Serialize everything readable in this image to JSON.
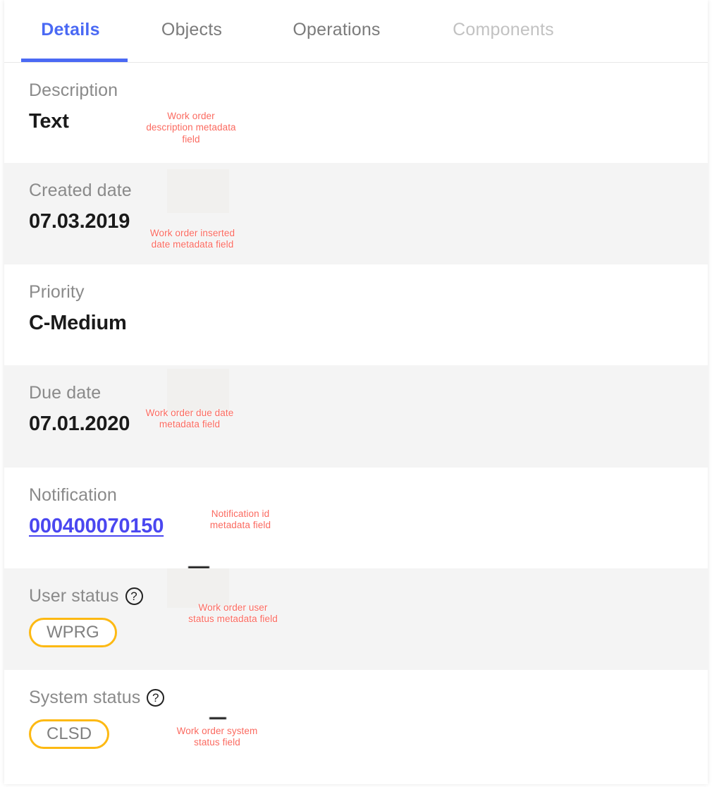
{
  "tabs": [
    {
      "label": "Details",
      "state": "active"
    },
    {
      "label": "Objects",
      "state": "normal"
    },
    {
      "label": "Operations",
      "state": "normal"
    },
    {
      "label": "Components",
      "state": "disabled"
    }
  ],
  "fields": [
    {
      "label": "Description",
      "value": "Text",
      "annotation": "Work order\ndescription metadata\nfield"
    },
    {
      "label": "Created date",
      "value": "07.03.2019",
      "annotation": "Work order inserted\ndate metadata field"
    },
    {
      "label": "Priority",
      "value": "C-Medium",
      "annotation": ""
    },
    {
      "label": "Due date",
      "value": "07.01.2020",
      "annotation": "Work order due date\nmetadata field"
    },
    {
      "label": "Notification",
      "value": "000400070150",
      "annotation": "Notification id\nmetadata field"
    },
    {
      "label": "User status",
      "value": "WPRG",
      "annotation": "Work order user\nstatus metadata field"
    },
    {
      "label": "System status",
      "value": "CLSD",
      "annotation": "Work order system\nstatus field"
    }
  ],
  "icons": {
    "help": "?"
  },
  "colors": {
    "accent_blue": "#4a69f4",
    "link_blue": "#4a47f0",
    "status_amber": "#fdb913",
    "annotation_red": "#fb6a60",
    "label_grey": "#8a8a8a",
    "row_grey": "#f4f4f4"
  }
}
